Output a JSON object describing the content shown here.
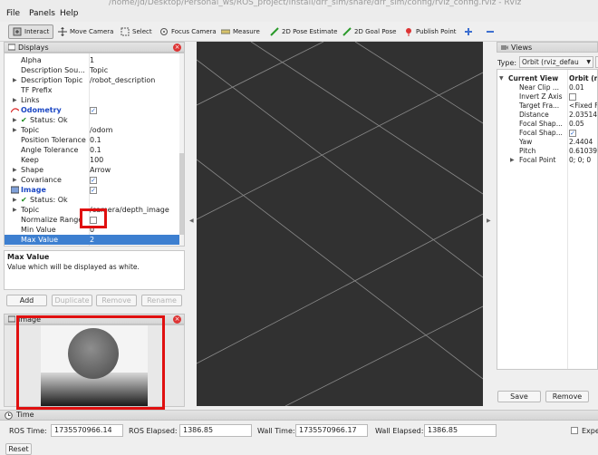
{
  "menubar": {
    "path": "/home/jd/Desktop/Personal_ws/ROS_project/install/drr_sim/share/drr_sim/config/rviz_config.rviz - RViz",
    "menus": [
      "File",
      "Panels",
      "Help"
    ]
  },
  "toolbar": {
    "tools": [
      {
        "label": "Interact",
        "icon": "interact-icon"
      },
      {
        "label": "Move Camera",
        "icon": "move-camera-icon"
      },
      {
        "label": "Select",
        "icon": "select-icon"
      },
      {
        "label": "Focus Camera",
        "icon": "focus-camera-icon"
      },
      {
        "label": "Measure",
        "icon": "measure-icon"
      },
      {
        "label": "2D Pose Estimate",
        "icon": "pose-estimate-icon"
      },
      {
        "label": "2D Goal Pose",
        "icon": "goal-pose-icon"
      },
      {
        "label": "Publish Point",
        "icon": "publish-point-icon"
      }
    ]
  },
  "displays": {
    "title": "Displays",
    "rows": [
      {
        "name": "Alpha",
        "value": "1"
      },
      {
        "name": "Description Sou...",
        "value": "Topic"
      },
      {
        "name": "Description Topic",
        "value": "/robot_description"
      },
      {
        "name": "TF Prefix",
        "value": ""
      },
      {
        "name": "Links",
        "value": ""
      },
      {
        "name": "Odometry",
        "value": "✓"
      },
      {
        "name": "Status: Ok",
        "value": ""
      },
      {
        "name": "Topic",
        "value": "/odom"
      },
      {
        "name": "Position Tolerance",
        "value": "0.1"
      },
      {
        "name": "Angle Tolerance",
        "value": "0.1"
      },
      {
        "name": "Keep",
        "value": "100"
      },
      {
        "name": "Shape",
        "value": "Arrow"
      },
      {
        "name": "Covariance",
        "value": "✓"
      },
      {
        "name": "Image",
        "value": "✓"
      },
      {
        "name": "Status: Ok",
        "value": ""
      },
      {
        "name": "Topic",
        "value": "/camera/depth_image"
      },
      {
        "name": "Normalize Range",
        "value": ""
      },
      {
        "name": "Min Value",
        "value": "0"
      },
      {
        "name": "Max Value",
        "value": "2"
      }
    ]
  },
  "description": {
    "title": "Max Value",
    "text": "Value which will be displayed as white."
  },
  "buttons": {
    "add": "Add",
    "duplicate": "Duplicate",
    "remove": "Remove",
    "rename": "Rename"
  },
  "image_panel": {
    "title": "Image"
  },
  "views": {
    "title": "Views",
    "type_label": "Type:",
    "type_value": "Orbit (rviz_defau",
    "zero_label": "Ze",
    "header_name": "Current View",
    "header_value": "Orbit (r",
    "rows": [
      {
        "name": "Near Clip ...",
        "value": "0.01"
      },
      {
        "name": "Invert Z Axis",
        "value": ""
      },
      {
        "name": "Target Fra...",
        "value": "<Fixed F"
      },
      {
        "name": "Distance",
        "value": "2.03514"
      },
      {
        "name": "Focal Shap...",
        "value": "0.05"
      },
      {
        "name": "Focal Shap...",
        "value": "✓"
      },
      {
        "name": "Yaw",
        "value": "2.4404"
      },
      {
        "name": "Pitch",
        "value": "0.61039"
      },
      {
        "name": "Focal Point",
        "value": "0; 0; 0"
      }
    ],
    "save": "Save",
    "remove": "Remove"
  },
  "time": {
    "title": "Time",
    "ros_time_label": "ROS Time:",
    "ros_time": "1735570966.14",
    "ros_elapsed_label": "ROS Elapsed:",
    "ros_elapsed": "1386.85",
    "wall_time_label": "Wall Time:",
    "wall_time": "1735570966.17",
    "wall_elapsed_label": "Wall Elapsed:",
    "wall_elapsed": "1386.85",
    "experimental": "Expe",
    "reset": "Reset"
  },
  "colors": {
    "view_bg": "#313131",
    "grid": "#8a8a8a",
    "selection": "#3d7fd0",
    "highlight": "#e01010"
  }
}
